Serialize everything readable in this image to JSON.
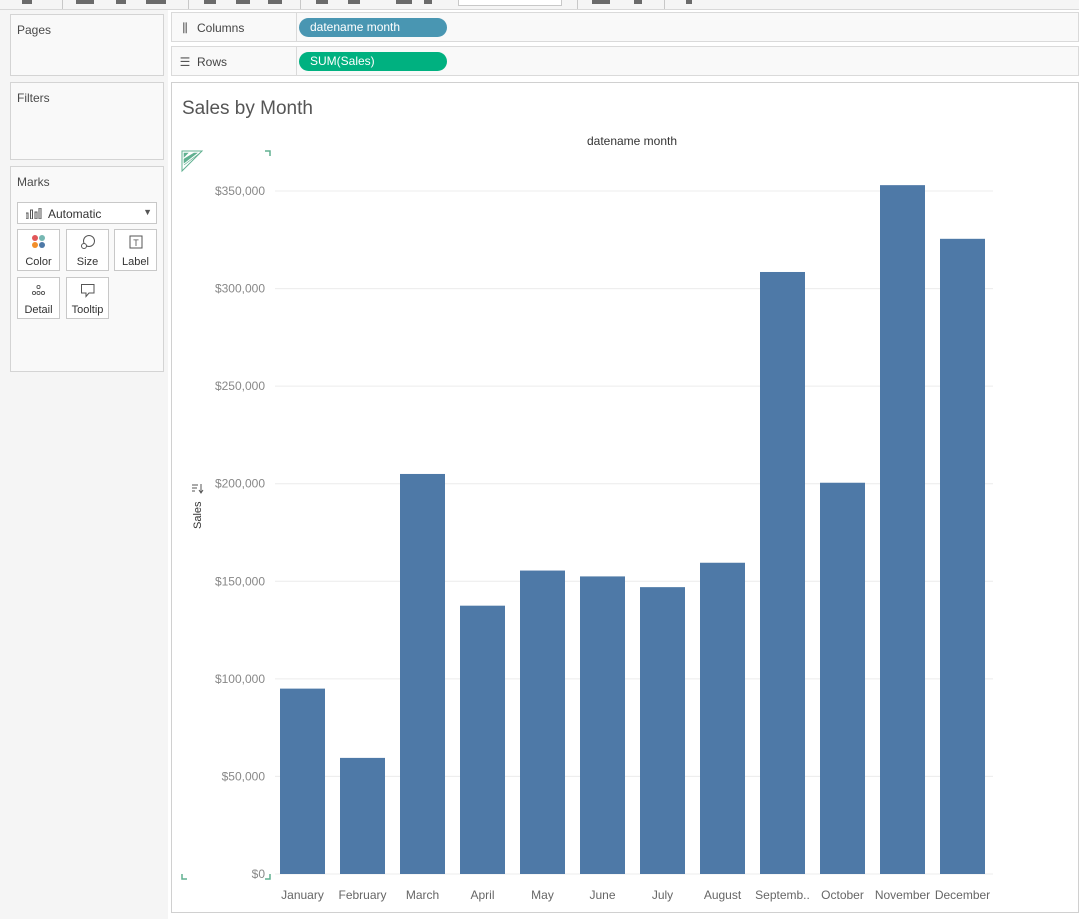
{
  "shelves": {
    "columns_label": "Columns",
    "columns_pill": "datename month",
    "rows_label": "Rows",
    "rows_pill": "SUM(Sales)"
  },
  "cards": {
    "pages": "Pages",
    "filters": "Filters",
    "marks": "Marks",
    "mark_type": "Automatic",
    "buttons": {
      "color": "Color",
      "size": "Size",
      "label": "Label",
      "detail": "Detail",
      "tooltip": "Tooltip"
    }
  },
  "colors": {
    "bar": "#4e79a7",
    "columns_pill": "#4996b2",
    "rows_pill": "#00b180"
  },
  "chart_data": {
    "type": "bar",
    "title": "Sales by Month",
    "header": "datename month",
    "ylabel": "Sales",
    "xlabel": "",
    "categories": [
      "January",
      "February",
      "March",
      "April",
      "May",
      "June",
      "July",
      "August",
      "Septemb..",
      "October",
      "November",
      "December"
    ],
    "values": [
      95000,
      59500,
      205000,
      137500,
      155500,
      152500,
      147000,
      159500,
      308500,
      200500,
      353000,
      325500
    ],
    "ylim": [
      0,
      370000
    ],
    "yticks": [
      0,
      50000,
      100000,
      150000,
      200000,
      250000,
      300000,
      350000
    ],
    "ytick_labels": [
      "$0",
      "$50,000",
      "$100,000",
      "$150,000",
      "$200,000",
      "$250,000",
      "$300,000",
      "$350,000"
    ],
    "grid": true,
    "legend": "none"
  }
}
